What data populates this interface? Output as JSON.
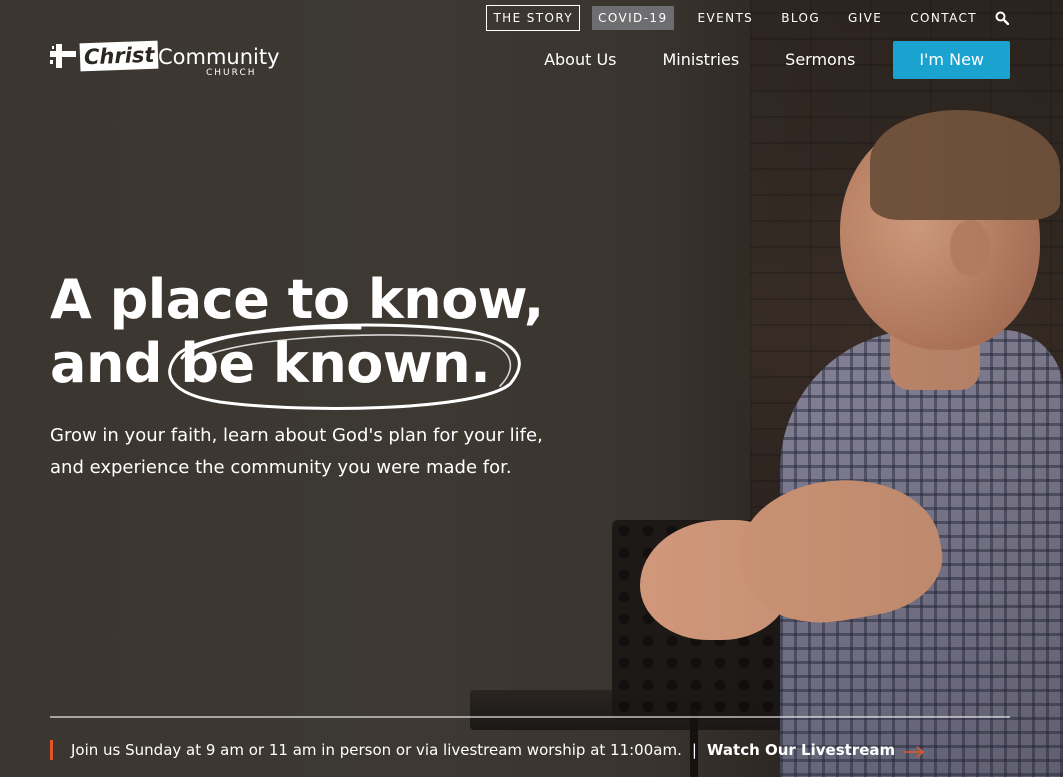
{
  "top_nav": {
    "items": [
      {
        "label": "THE STORY"
      },
      {
        "label": "COVID-19"
      },
      {
        "label": "EVENTS"
      },
      {
        "label": "BLOG"
      },
      {
        "label": "GIVE"
      },
      {
        "label": "CONTACT"
      }
    ],
    "search_icon": "search-icon"
  },
  "logo": {
    "christ": "Christ",
    "community": "Community",
    "church": "CHURCH"
  },
  "main_nav": {
    "items": [
      {
        "label": "About Us"
      },
      {
        "label": "Ministries"
      },
      {
        "label": "Sermons"
      }
    ],
    "cta_label": "I'm New"
  },
  "hero": {
    "headline_line1": "A place to know,",
    "headline_line2": "and be known.",
    "subtext": "Grow in your faith, learn about God's plan for your life, and experience the community you were made for."
  },
  "bottom_bar": {
    "text": "Join us Sunday at 9 am or 11 am in person or via livestream worship at 11:00am.",
    "separator": "|",
    "link_label": "Watch Our Livestream",
    "arrow_icon": "arrow-right-icon"
  },
  "colors": {
    "cta": "#1aa3cf",
    "accent": "#e0562a",
    "covid_bg": "#6e6e70"
  }
}
